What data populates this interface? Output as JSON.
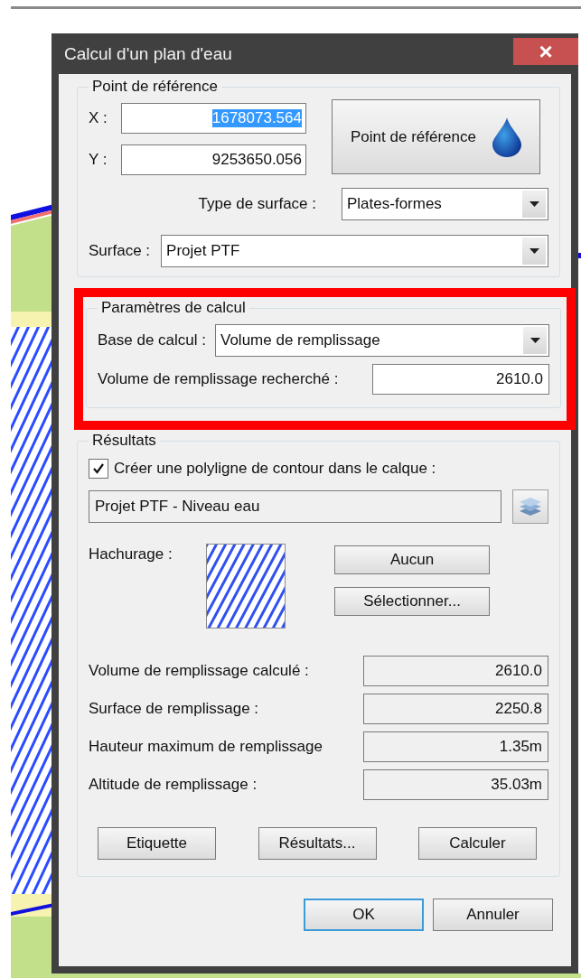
{
  "window": {
    "title": "Calcul d'un plan d'eau",
    "close": "×"
  },
  "reference_group": {
    "legend": "Point de référence",
    "x": {
      "label": "X :",
      "value": "1678073.564",
      "text_selected": true
    },
    "y": {
      "label": "Y :",
      "value": "9253650.056",
      "text_selected": false
    },
    "pick_button": "Point de référence",
    "surface_type": {
      "label": "Type de surface :",
      "value": "Plates-formes"
    },
    "surface": {
      "label": "Surface :",
      "value": "Projet PTF"
    }
  },
  "parameters_group": {
    "legend": "Paramètres de calcul",
    "highlighted": true,
    "basis": {
      "label": "Base de calcul :",
      "value": "Volume de remplissage"
    },
    "target": {
      "label": "Volume de remplissage recherché :",
      "value": "2610.0"
    }
  },
  "results_group": {
    "legend": "Résultats",
    "polyline": {
      "label": "Créer une polyligne de contour dans le calque :",
      "checked": true
    },
    "layer": {
      "value": "Projet PTF - Niveau eau"
    },
    "hatch": {
      "label": "Hachurage :",
      "buttons": [
        "Aucun",
        "Sélectionner..."
      ]
    },
    "outputs": [
      {
        "label": "Volume de remplissage calculé :",
        "value": "2610.0"
      },
      {
        "label": "Surface de remplissage :",
        "value": "2250.8"
      },
      {
        "label": "Hauteur maximum de remplissage",
        "value": "1.35m"
      },
      {
        "label": "Altitude de remplissage :",
        "value": "35.03m"
      }
    ],
    "buttons": [
      "Etiquette",
      "Résultats...",
      "Calculer"
    ]
  },
  "footer_buttons": [
    {
      "label": "OK",
      "default": true
    },
    {
      "label": "Annuler",
      "default": false
    }
  ]
}
